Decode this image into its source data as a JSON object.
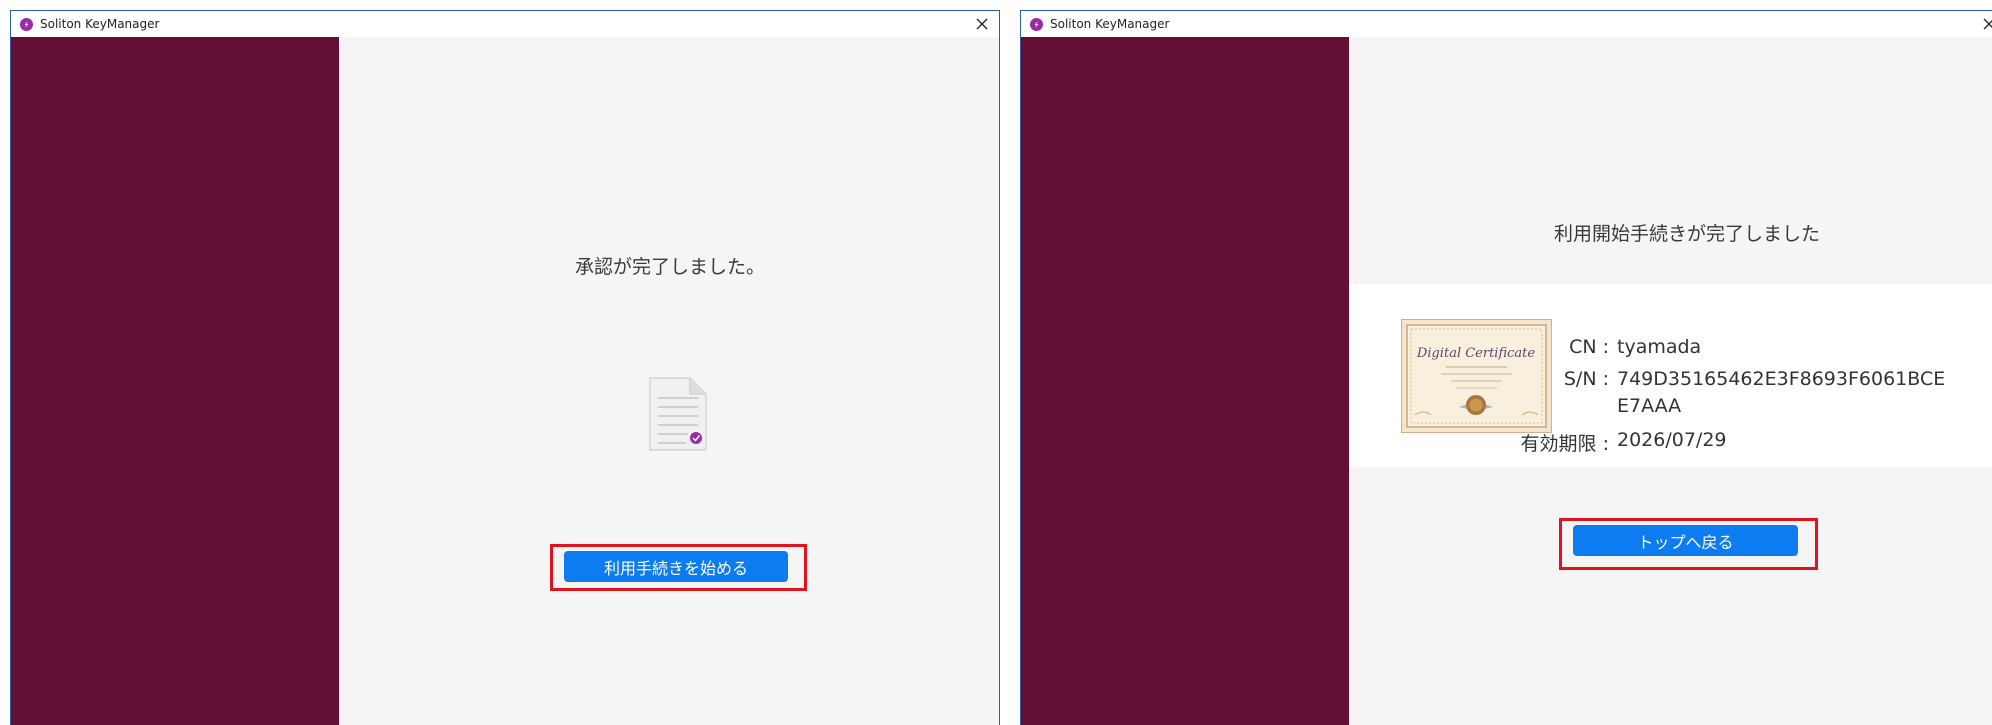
{
  "window1": {
    "title": "Soliton KeyManager",
    "message": "承認が完了しました。",
    "start_button_label": "利用手続きを始める"
  },
  "window2": {
    "title": "Soliton KeyManager",
    "message": "利用開始手続きが完了しました",
    "certificate": {
      "image_text": "Digital Certificate",
      "cn_label": "CN :",
      "cn_value": "tyamada",
      "sn_label": "S/N :",
      "sn_value_line1": "749D35165462E3F8693F6061BCE",
      "sn_value_line2": "E7AAA",
      "expiry_label": "有効期限 :",
      "expiry_value": "2026/07/29"
    },
    "back_button_label": "トップへ戻る"
  },
  "colors": {
    "sidebar": "#640f36",
    "content_background": "#f4f5f4",
    "primary_button": "#0d7cf0",
    "highlight_border": "#e0141c",
    "app_icon": "#9a2ba6"
  },
  "icons": [
    "app-icon",
    "close-icon",
    "document-check-icon",
    "certificate-image"
  ]
}
